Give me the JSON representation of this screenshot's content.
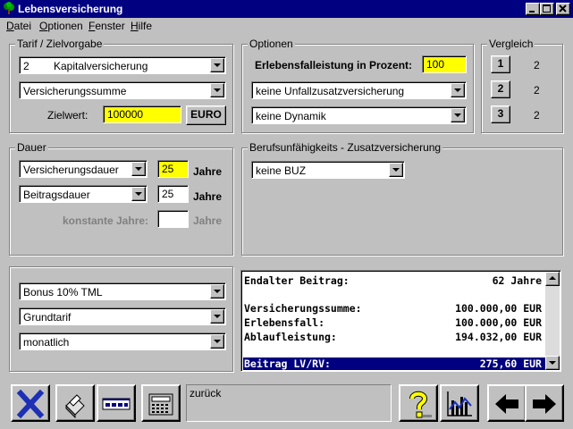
{
  "window": {
    "title": "Lebensversicherung"
  },
  "menu": [
    "Datei",
    "Optionen",
    "Fenster",
    "Hilfe"
  ],
  "menu_mnemonic": [
    "D",
    "O",
    "F",
    "H"
  ],
  "tarif": {
    "title": "Tarif / Zielvorgabe",
    "tarif_no": "2",
    "tarif_name": "Kapitalversicherung",
    "ziel_type": "Versicherungssumme",
    "zielwert_label": "Zielwert:",
    "zielwert_value": "100000",
    "currency_button": "EURO"
  },
  "optionen": {
    "title": "Optionen",
    "erlebensfall_label": "Erlebensfalleistung in Prozent:",
    "erlebensfall_value": "100",
    "unfall": "keine Unfallzusatzversicherung",
    "dynamik": "keine Dynamik"
  },
  "vergleich": {
    "title": "Vergleich",
    "items": [
      {
        "button": "1",
        "value": "2"
      },
      {
        "button": "2",
        "value": "2"
      },
      {
        "button": "3",
        "value": "2"
      }
    ]
  },
  "dauer": {
    "title": "Dauer",
    "vers_dauer_select": "Versicherungsdauer",
    "vers_dauer_value": "25",
    "beitrags_dauer_select": "Beitragsdauer",
    "beitrags_dauer_value": "25",
    "konstante_label": "konstante Jahre:",
    "konstante_value": "",
    "unit": "Jahre"
  },
  "buz": {
    "title": "Berufsunfähigkeits - Zusatzversicherung",
    "select": "keine BUZ"
  },
  "extras": {
    "bonus": "Bonus 10% TML",
    "grundtarif": "Grundtarif",
    "zahlweise": "monatlich"
  },
  "results": {
    "rows": [
      {
        "label": "Endalter Beitrag:",
        "value": "62 Jahre"
      },
      {
        "label": "Versicherungssumme:",
        "value": "100.000,00 EUR"
      },
      {
        "label": "Erlebensfall:",
        "value": "100.000,00 EUR"
      },
      {
        "label": "Ablaufleistung:",
        "value": "194.032,00 EUR"
      },
      {
        "label": "Beitrag LV/RV:",
        "value": "275,60 EUR"
      }
    ]
  },
  "status": {
    "text": "zurück"
  },
  "colors": {
    "titlebar": "#000080",
    "highlight": "#ffff00",
    "selection": "#000080",
    "close_x": "#1c2fb5"
  }
}
